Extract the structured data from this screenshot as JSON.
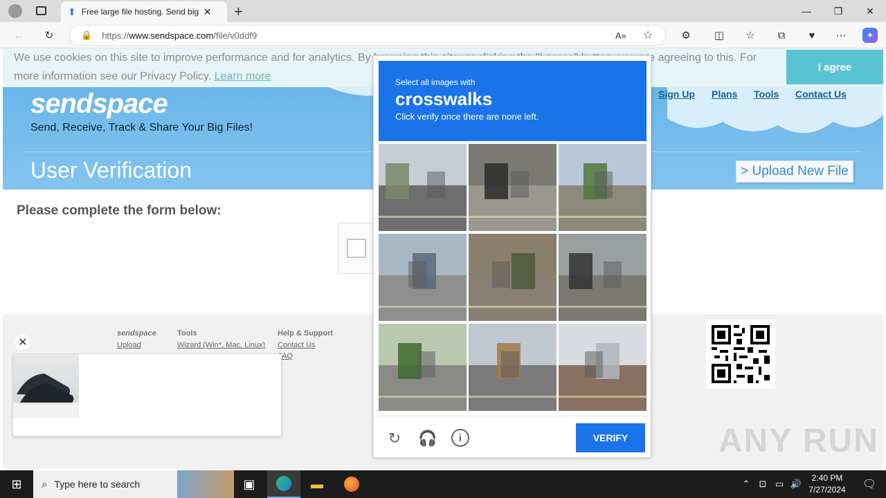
{
  "browser": {
    "tab_title": "Free large file hosting. Send big f",
    "new_tab_icon": "+",
    "url_prefix": "https://",
    "url_domain": "www.sendspace.com",
    "url_path": "/file/v0ddf9"
  },
  "cookie": {
    "text_before": "We use cookies on this site to improve performance and for analytics. By browsing this site, or clicking the \"I agree\" button, you are agreeing to this. For more information see our Privacy Policy. ",
    "learn_more": "Learn more",
    "agree_label": "I agree"
  },
  "header": {
    "logo": "sendspace",
    "tagline": "Send, Receive, Track & Share Your Big Files!",
    "nav": [
      "Sign Up",
      "Plans",
      "Tools",
      "Contact Us"
    ],
    "page_title": "User Verification",
    "upload_label": "> Upload New File"
  },
  "main": {
    "form_heading": "Please complete the form below:"
  },
  "footer": {
    "col1_title": "sendspace",
    "col1_links": [
      "Upload"
    ],
    "col2_title": "Tools",
    "col2_links": [
      "Wizard (Win*, Mac, Linux)"
    ],
    "col3_title": "Help & Support",
    "col3_links": [
      "Contact Us",
      "FAQ"
    ]
  },
  "captcha": {
    "instruction_small": "Select all images with",
    "instruction_target": "crosswalks",
    "instruction_note": "Click verify once there are none left.",
    "verify_label": "VERIFY",
    "tiles": [
      {
        "name": "tile-street-traffic",
        "sky": "#c6cdd6",
        "ground": "#6e6e6e",
        "accent": "#7a8a6a"
      },
      {
        "name": "tile-motorcycle",
        "sky": "#7a7a72",
        "ground": "#9a978e",
        "accent": "#2b2b2b"
      },
      {
        "name": "tile-tunnel",
        "sky": "#b9c7d8",
        "ground": "#8a8a7a",
        "accent": "#4f7a3a"
      },
      {
        "name": "tile-highway",
        "sky": "#a9b6c6",
        "ground": "#8f8f8f",
        "accent": "#5a6a7a"
      },
      {
        "name": "tile-cyclist",
        "sky": "#8a7f6a",
        "ground": "#8a7f74",
        "accent": "#4a5a3a"
      },
      {
        "name": "tile-bicycle",
        "sky": "#9aa0a0",
        "ground": "#7a7a72",
        "accent": "#333333"
      },
      {
        "name": "tile-traffic-light",
        "sky": "#b9c9b0",
        "ground": "#8a8a86",
        "accent": "#3f6a2f"
      },
      {
        "name": "tile-shop-street",
        "sky": "#c0c8d2",
        "ground": "#7a7a7a",
        "accent": "#a07a4a"
      },
      {
        "name": "tile-awning",
        "sky": "#d8dce0",
        "ground": "#8a7060",
        "accent": "#b0b6bc"
      }
    ]
  },
  "taskbar": {
    "search_placeholder": "Type here to search",
    "time": "2:40 PM",
    "date": "7/27/2024"
  },
  "watermark": "ANY RUN"
}
